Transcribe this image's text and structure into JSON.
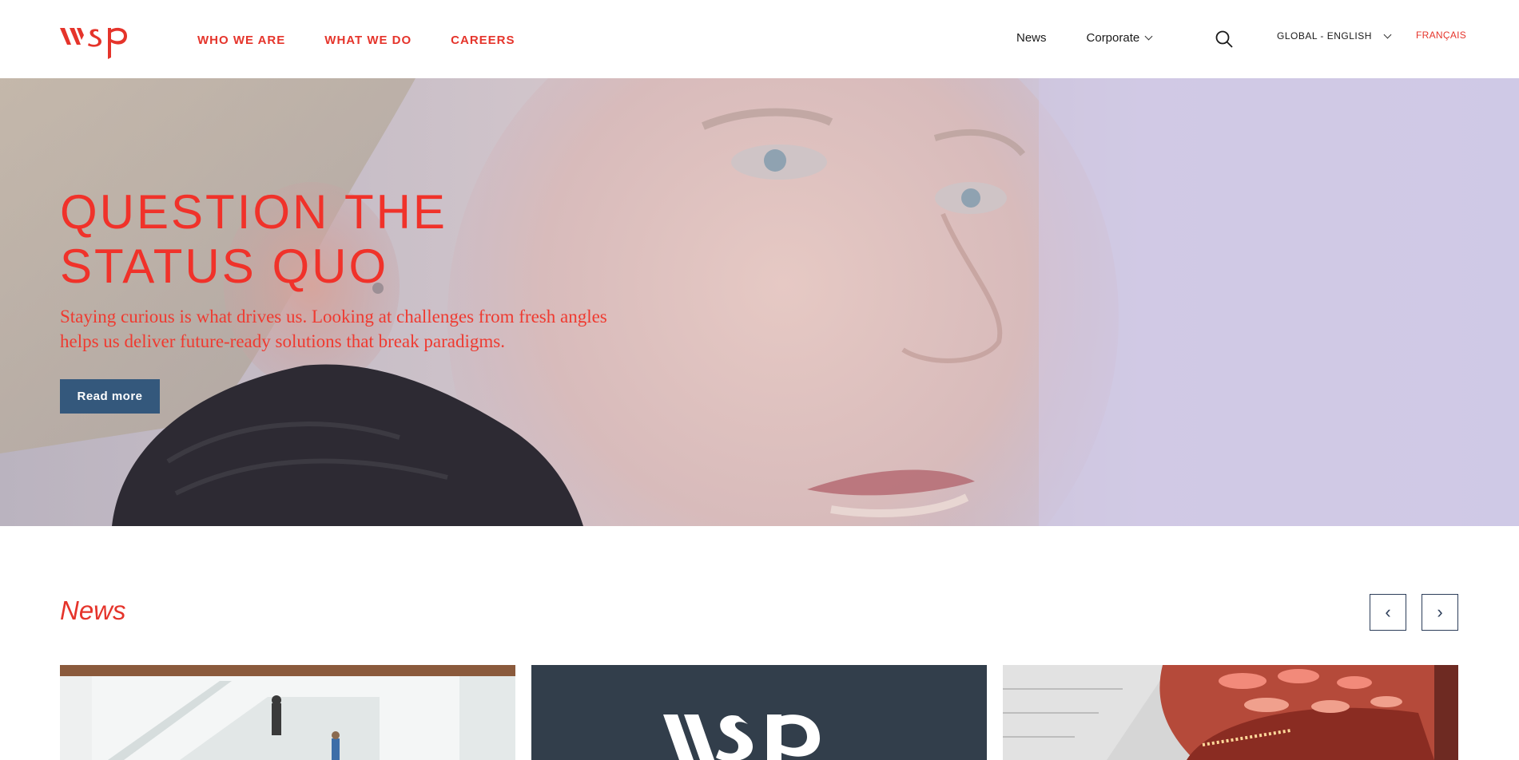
{
  "brand": {
    "logo_text": "wsp",
    "accent_color": "#e5342b",
    "button_color": "#34587c"
  },
  "header": {
    "main_nav": [
      {
        "label": "WHO WE ARE"
      },
      {
        "label": "WHAT WE DO"
      },
      {
        "label": "CAREERS"
      }
    ],
    "news_link": "News",
    "corporate_label": "Corporate",
    "corporate_icon": "chevron-down-icon",
    "search_icon": "search-icon",
    "language_label": "GLOBAL - ENGLISH",
    "language_icon": "chevron-down-icon",
    "alt_language": "FRANÇAIS"
  },
  "hero": {
    "title_line1": "QUESTION THE",
    "title_line2": "STATUS QUO",
    "subtitle": "Staying curious is what drives us. Looking at challenges from fresh angles helps us deliver future-ready solutions that break paradigms.",
    "cta_label": "Read more"
  },
  "news": {
    "title": "News",
    "prev_icon": "chevron-left-icon",
    "next_icon": "chevron-right-icon",
    "prev_glyph": "‹",
    "next_glyph": "›",
    "cards": [
      {
        "image": "atrium-staircase-photo"
      },
      {
        "image": "wsp-logo-card",
        "logo_text": "wsp"
      },
      {
        "image": "red-ceiling-interior-photo"
      }
    ]
  }
}
